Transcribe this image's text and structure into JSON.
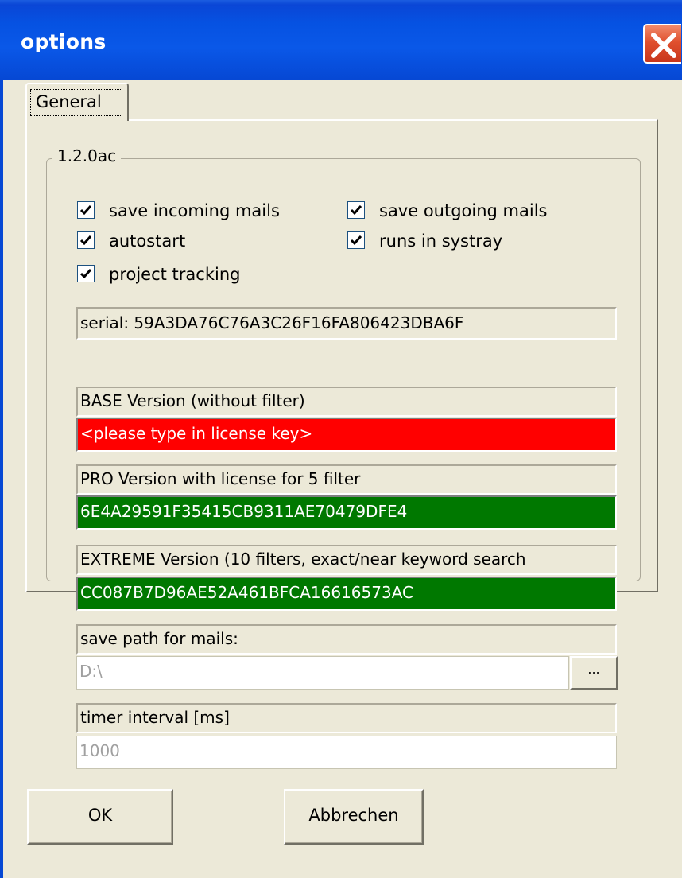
{
  "window": {
    "title": "options",
    "close_icon": "close-icon"
  },
  "tabs": [
    {
      "label": "General",
      "selected": true
    }
  ],
  "group": {
    "title": "1.2.0ac"
  },
  "options": {
    "save_incoming": {
      "label": "save incoming mails",
      "checked": true
    },
    "save_outgoing": {
      "label": "save outgoing mails",
      "checked": true
    },
    "autostart": {
      "label": "autostart",
      "checked": true
    },
    "systray": {
      "label": "runs in systray",
      "checked": true
    },
    "project_tracking": {
      "label": "project tracking",
      "checked": true
    }
  },
  "serial": {
    "text": "serial: 59A3DA76C76A3C26F16FA806423DBA6F"
  },
  "licenses": {
    "base": {
      "label": "BASE Version (without filter)",
      "value": "<please type in license key>",
      "color": "#ff0000"
    },
    "pro": {
      "label": "PRO Version with license for 5 filter",
      "value": "6E4A29591F35415CB9311AE70479DFE4",
      "color": "#007800"
    },
    "extreme": {
      "label": "EXTREME Version (10 filters, exact/near keyword search",
      "value": "CC087B7D96AE52A461BFCA16616573AC",
      "color": "#007800"
    }
  },
  "save_path": {
    "label": "save path for mails:",
    "value": "D:\\",
    "browse_label": "..."
  },
  "timer": {
    "label": "timer interval [ms]",
    "value": "1000"
  },
  "buttons": {
    "ok": "OK",
    "cancel": "Abbrechen"
  }
}
